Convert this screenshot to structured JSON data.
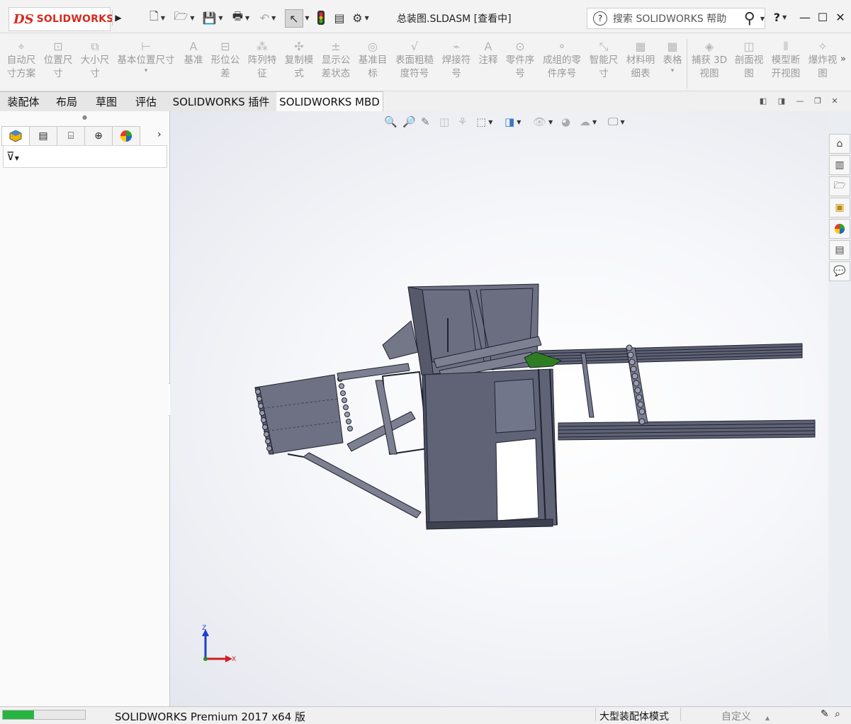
{
  "app": {
    "brand_ds": "DS",
    "brand_name": "SOLIDWORKS",
    "document_title": "总装图.SLDASM [查看中]",
    "search_placeholder": "搜索 SOLIDWORKS 帮助",
    "help_label": "?"
  },
  "quick_access": [
    "new-document-icon",
    "open-icon",
    "save-icon",
    "print-icon",
    "undo-icon",
    "select-icon",
    "rebuild-icon",
    "file-properties-icon",
    "options-icon"
  ],
  "command_manager": [
    {
      "id": "auto-dim",
      "label": "自动尺\n寸方案",
      "icon": "auto-dimension-icon"
    },
    {
      "id": "location-dim",
      "label": "位置尺\n寸",
      "icon": "location-dimension-icon"
    },
    {
      "id": "size-dim",
      "label": "大小尺\n寸",
      "icon": "size-dimension-icon"
    },
    {
      "id": "basic-location-dim",
      "label": "基本位置尺寸",
      "icon": "basic-location-dimension-icon"
    },
    {
      "id": "datum",
      "label": "基准",
      "icon": "datum-icon"
    },
    {
      "id": "geo-tol",
      "label": "形位公\n差",
      "icon": "geometric-tolerance-icon"
    },
    {
      "id": "pattern-feature",
      "label": "阵列特\n征",
      "icon": "pattern-feature-icon"
    },
    {
      "id": "copy-scheme",
      "label": "复制模\n式",
      "icon": "copy-scheme-icon"
    },
    {
      "id": "show-tol-status",
      "label": "显示公\n差状态",
      "icon": "tolerance-status-icon"
    },
    {
      "id": "datum-target",
      "label": "基准目\n标",
      "icon": "datum-target-icon"
    },
    {
      "id": "surface-finish",
      "label": "表面粗糙\n度符号",
      "icon": "surface-finish-icon"
    },
    {
      "id": "weld-symbol",
      "label": "焊接符\n号",
      "icon": "weld-symbol-icon"
    },
    {
      "id": "note",
      "label": "注释",
      "icon": "note-icon"
    },
    {
      "id": "balloon",
      "label": "零件序\n号",
      "icon": "balloon-icon"
    },
    {
      "id": "auto-balloon",
      "label": "成组的零\n件序号",
      "icon": "auto-balloon-icon"
    },
    {
      "id": "smart-dim",
      "label": "智能尺\n寸",
      "icon": "smart-dimension-icon"
    },
    {
      "id": "bom",
      "label": "材料明\n细表",
      "icon": "bom-icon"
    },
    {
      "id": "table",
      "label": "表格",
      "icon": "table-icon"
    },
    {
      "id": "capture-3d",
      "label": "捕获 3D\n视图",
      "icon": "capture-3d-view-icon"
    },
    {
      "id": "section-view",
      "label": "剖面视\n图",
      "icon": "section-view-icon"
    },
    {
      "id": "model-break",
      "label": "模型断\n开视图",
      "icon": "model-break-view-icon"
    },
    {
      "id": "explode-view",
      "label": "爆炸视\n图",
      "icon": "explode-view-icon"
    }
  ],
  "tabs": [
    {
      "label": "装配体",
      "active": false
    },
    {
      "label": "布局",
      "active": false
    },
    {
      "label": "草图",
      "active": false
    },
    {
      "label": "评估",
      "active": false
    },
    {
      "label": "SOLIDWORKS 插件",
      "active": false
    },
    {
      "label": "SOLIDWORKS MBD",
      "active": true
    }
  ],
  "left_panel_tabs": [
    "feature-manager-icon",
    "property-manager-icon",
    "configuration-manager-icon",
    "dimxpert-icon",
    "display-manager-icon"
  ],
  "heads_up_toolbar": [
    "zoom-to-fit-icon",
    "zoom-to-area-icon",
    "previous-view-icon",
    "section-view-icon",
    "dynamic-annotation-icon",
    "view-orientation-icon",
    "display-style-icon",
    "hide-show-icon",
    "edit-appearance-icon",
    "apply-scene-icon",
    "view-settings-icon"
  ],
  "task_pane": [
    "home-icon",
    "design-library-icon",
    "file-explorer-icon",
    "view-palette-icon",
    "appearances-icon",
    "custom-properties-icon",
    "forum-icon"
  ],
  "triad": {
    "z": "Z",
    "x": "X"
  },
  "status_bar": {
    "product": "SOLIDWORKS Premium 2017 x64 版",
    "mode": "大型装配体模式",
    "custom": "自定义",
    "progress": 0.38
  },
  "colors": {
    "brand": "#d52b1e",
    "accent_green": "#26b540",
    "model_fill": "#6b6f80",
    "model_edge": "#1f2230"
  }
}
